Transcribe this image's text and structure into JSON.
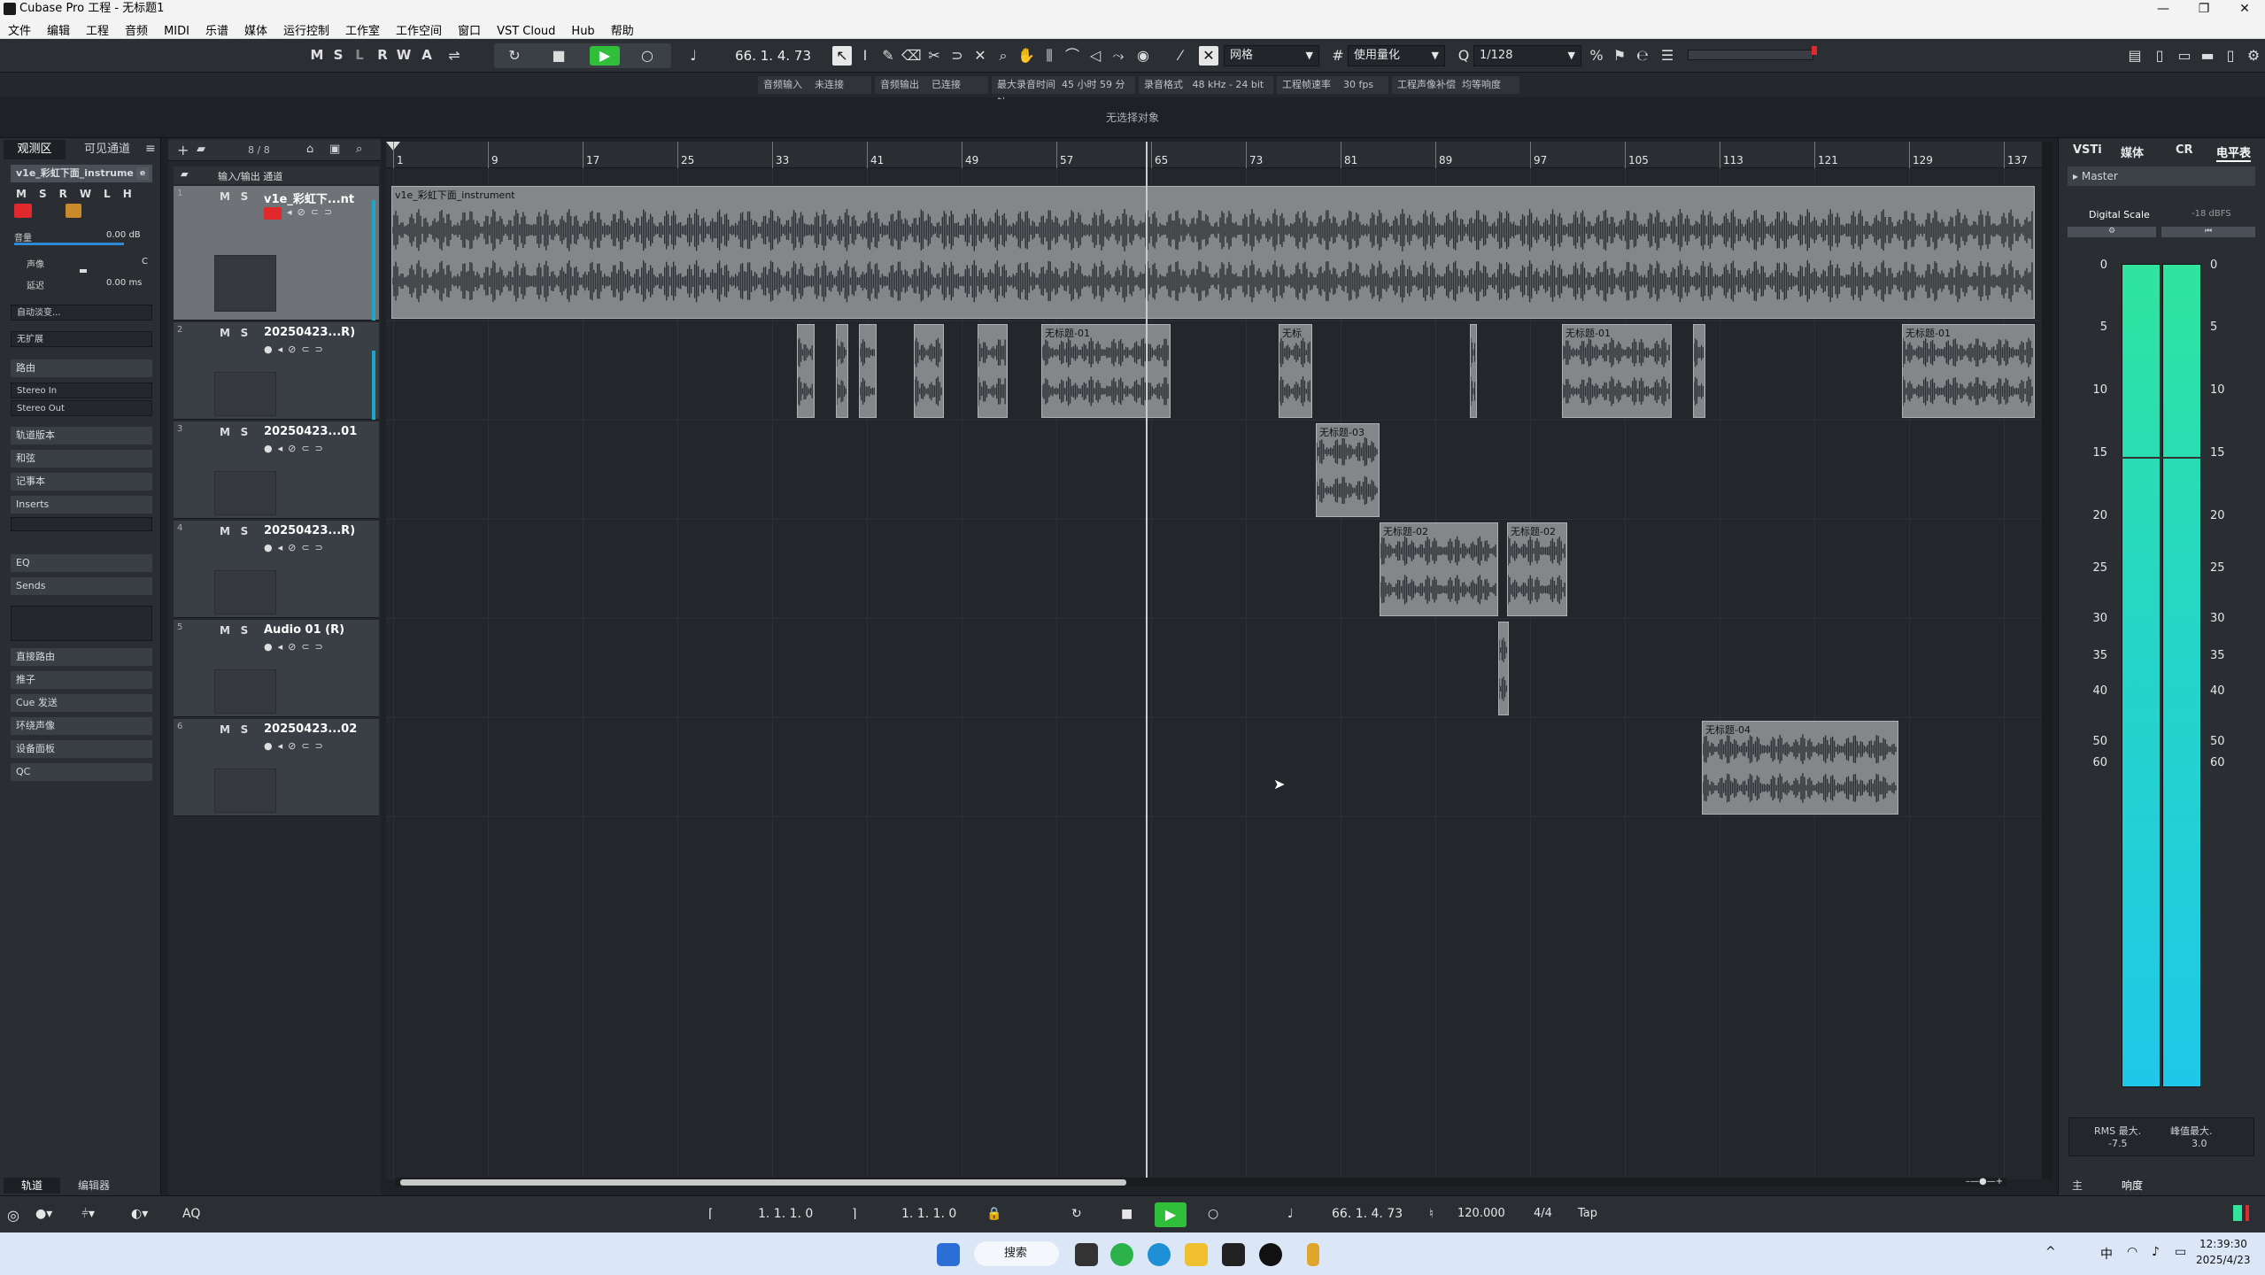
{
  "window": {
    "title": "Cubase Pro 工程 - 无标题1",
    "controls": [
      "—",
      "❐",
      "✕"
    ]
  },
  "menu": [
    "文件",
    "编辑",
    "工程",
    "音频",
    "MIDI",
    "乐谱",
    "媒体",
    "运行控制",
    "工作室",
    "工作空间",
    "窗口",
    "VST Cloud",
    "Hub",
    "帮助"
  ],
  "toolbar": {
    "mode_buttons": [
      "M",
      "S",
      "L",
      "R",
      "W",
      "A"
    ],
    "position": "66. 1. 4. 73",
    "snap_type": "网格",
    "quantize_mode": "使用量化",
    "quantize_value": "1/128"
  },
  "status_strip": [
    {
      "label": "音频输入",
      "value": "未连接"
    },
    {
      "label": "音频输出",
      "value": "已连接"
    },
    {
      "label": "最大录音时间",
      "value": "45 小时 59 分钟"
    },
    {
      "label": "录音格式",
      "value": "48 kHz - 24 bit"
    },
    {
      "label": "工程帧速率",
      "value": "30 fps"
    },
    {
      "label": "工程声像补偿",
      "value": "均等响度"
    }
  ],
  "info_line": "无选择对象",
  "inspector": {
    "tabs": [
      "观测区",
      "可见通道"
    ],
    "track_name": "v1e_彩虹下面_instrume",
    "volume_label": "音量",
    "volume_value": "0.00 dB",
    "pan_label": "声像",
    "pan_value": "C",
    "delay_label": "延迟",
    "delay_value": "0.00 ms",
    "auto_fade": "自动淡变...",
    "no_expand": "无扩展",
    "routing_label": "路由",
    "routing_in": "Stereo In",
    "routing_out": "Stereo Out",
    "sections": [
      "轨道版本",
      "和弦",
      "记事本",
      "Inserts",
      "EQ",
      "Sends",
      "直接路由",
      "推子",
      "Cue 发送",
      "环绕声像",
      "设备面板",
      "QC"
    ],
    "bottom_tabs": [
      "轨道",
      "编辑器"
    ]
  },
  "tracklist": {
    "count": "8 / 8",
    "folder_label": "输入/输出 通道",
    "tracks": [
      {
        "num": "1",
        "name": "v1e_彩虹下...nt"
      },
      {
        "num": "2",
        "name": "20250423...R)"
      },
      {
        "num": "3",
        "name": "20250423...01"
      },
      {
        "num": "4",
        "name": "20250423...R)"
      },
      {
        "num": "5",
        "name": "Audio 01 (R)"
      },
      {
        "num": "6",
        "name": "20250423...02"
      }
    ]
  },
  "ruler": {
    "bars": [
      "1",
      "9",
      "17",
      "25",
      "33",
      "41",
      "49",
      "57",
      "65",
      "73",
      "81",
      "89",
      "97",
      "105",
      "113",
      "121",
      "129",
      "137"
    ]
  },
  "events": {
    "track1": "v1e_彩虹下面_instrument",
    "t2_a": "无标题-01",
    "t2_b": "无标",
    "t2_c": "无标题-01",
    "t2_d": "无标题-01",
    "t3": "无标题-03",
    "t4_a": "无标题-02",
    "t4_b": "无标题-02",
    "t6": "无标题-04"
  },
  "rack": {
    "tabs": [
      "VSTi",
      "媒体",
      "CR",
      "电平表"
    ],
    "master": "Master",
    "scale": "Digital Scale",
    "ref": "-18 dBFS",
    "ticks": [
      "0",
      "5",
      "10",
      "15",
      "20",
      "25",
      "30",
      "35",
      "40",
      "50",
      "60"
    ],
    "rms_label": "RMS 最大.",
    "rms_value": "-7.5",
    "peak_label": "峰值最大.",
    "peak_value": "3.0",
    "bottom_tabs": [
      "主",
      "响度"
    ]
  },
  "transport": {
    "aq": "AQ",
    "left_locator": "1. 1. 1. 0",
    "right_locator": "1. 1. 1. 0",
    "position": "66. 1. 4. 73",
    "tempo": "120.000",
    "signature": "4/4",
    "tap": "Tap"
  },
  "taskbar": {
    "search": "搜索",
    "time": "12:39:30",
    "date": "2025/4/23",
    "ime": "中"
  },
  "colors": {
    "record": "#e0282d",
    "play": "#2fbf3a",
    "meter_top": "#30e49e",
    "meter_bottom": "#1fc8e8"
  }
}
